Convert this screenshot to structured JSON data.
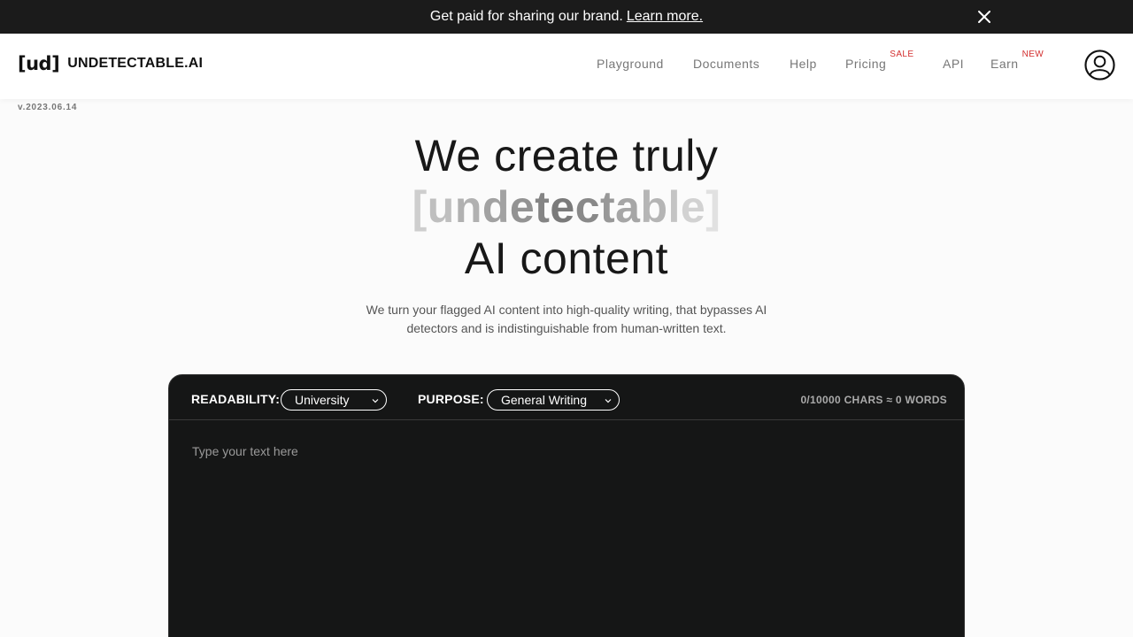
{
  "promo": {
    "text": "Get paid for sharing our brand.",
    "link": "Learn more."
  },
  "header": {
    "logo_mark": "[ud]",
    "logo_text": "UNDETECTABLE.AI",
    "nav": [
      {
        "label": "Playground"
      },
      {
        "label": "Documents"
      },
      {
        "label": "Help"
      },
      {
        "label": "Pricing",
        "badge": "SALE"
      },
      {
        "label": "API"
      },
      {
        "label": "Earn",
        "badge": "NEW"
      }
    ]
  },
  "version": "v.2023.06.14",
  "hero": {
    "line1": "We create truly",
    "line2": "[undetectable]",
    "line3": "AI content",
    "subtitle": "We turn your flagged AI content into high-quality writing, that bypasses AI detectors and is indistinguishable from human-written text."
  },
  "editor": {
    "readability_label": "READABILITY:",
    "readability_value": "University",
    "purpose_label": "PURPOSE:",
    "purpose_value": "General Writing",
    "counter": "0/10000 CHARS ≈ 0 WORDS",
    "placeholder": "Type your text here"
  },
  "colors": {
    "badge": "#d32f2f",
    "editor_bg": "#151616",
    "promo_bg": "#1b1b1b"
  }
}
